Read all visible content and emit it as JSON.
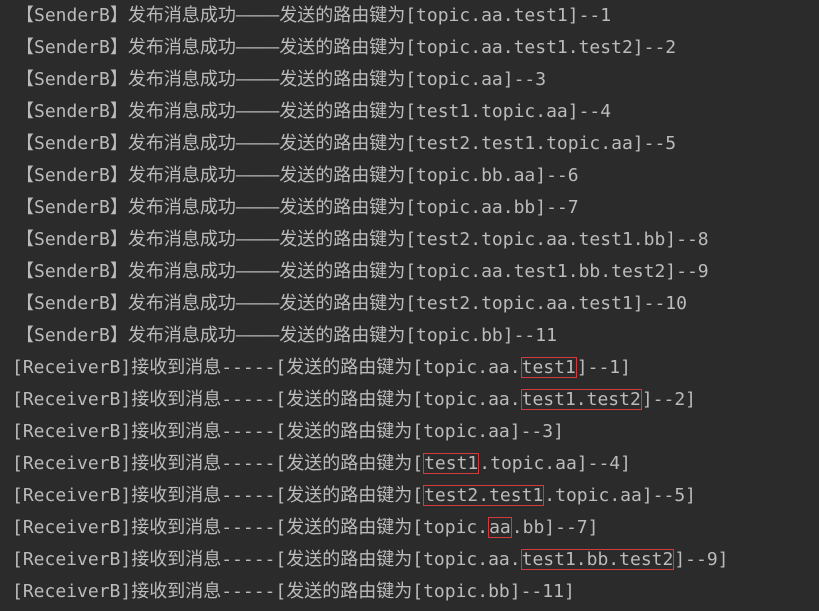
{
  "console": {
    "sender_lines": [
      "【SenderB】发布消息成功————发送的路由键为[topic.aa.test1]--1",
      "【SenderB】发布消息成功————发送的路由键为[topic.aa.test1.test2]--2",
      "【SenderB】发布消息成功————发送的路由键为[topic.aa]--3",
      "【SenderB】发布消息成功————发送的路由键为[test1.topic.aa]--4",
      "【SenderB】发布消息成功————发送的路由键为[test2.test1.topic.aa]--5",
      "【SenderB】发布消息成功————发送的路由键为[topic.bb.aa]--6",
      "【SenderB】发布消息成功————发送的路由键为[topic.aa.bb]--7",
      "【SenderB】发布消息成功————发送的路由键为[test2.topic.aa.test1.bb]--8",
      "【SenderB】发布消息成功————发送的路由键为[topic.aa.test1.bb.test2]--9",
      "【SenderB】发布消息成功————发送的路由键为[test2.topic.aa.test1]--10",
      "【SenderB】发布消息成功————发送的路由键为[topic.bb]--11"
    ],
    "receiver_lines": [
      {
        "pre": "[ReceiverB]接收到消息-----[发送的路由键为[topic.aa.",
        "hl": "test1",
        "post": "]--1]"
      },
      {
        "pre": "[ReceiverB]接收到消息-----[发送的路由键为[topic.aa.",
        "hl": "test1.test2",
        "post": "]--2]"
      },
      {
        "pre": "[ReceiverB]接收到消息-----[发送的路由键为[topic.aa]--3]",
        "hl": "",
        "post": ""
      },
      {
        "pre": "[ReceiverB]接收到消息-----[发送的路由键为[",
        "hl": "test1",
        "post": ".topic.aa]--4]"
      },
      {
        "pre": "[ReceiverB]接收到消息-----[发送的路由键为[",
        "hl": "test2.test1",
        "post": ".topic.aa]--5]"
      },
      {
        "pre": "[ReceiverB]接收到消息-----[发送的路由键为[topic.",
        "hl": "aa",
        "post": ".bb]--7]"
      },
      {
        "pre": "[ReceiverB]接收到消息-----[发送的路由键为[topic.aa.",
        "hl": "test1.bb.test2",
        "post": "]--9]"
      },
      {
        "pre": "[ReceiverB]接收到消息-----[发送的路由键为[topic.bb]--11]",
        "hl": "",
        "post": ""
      }
    ]
  },
  "colors": {
    "background": "#2b2b2b",
    "text": "#bbbbbb",
    "highlight_border": "#d23b3b"
  }
}
